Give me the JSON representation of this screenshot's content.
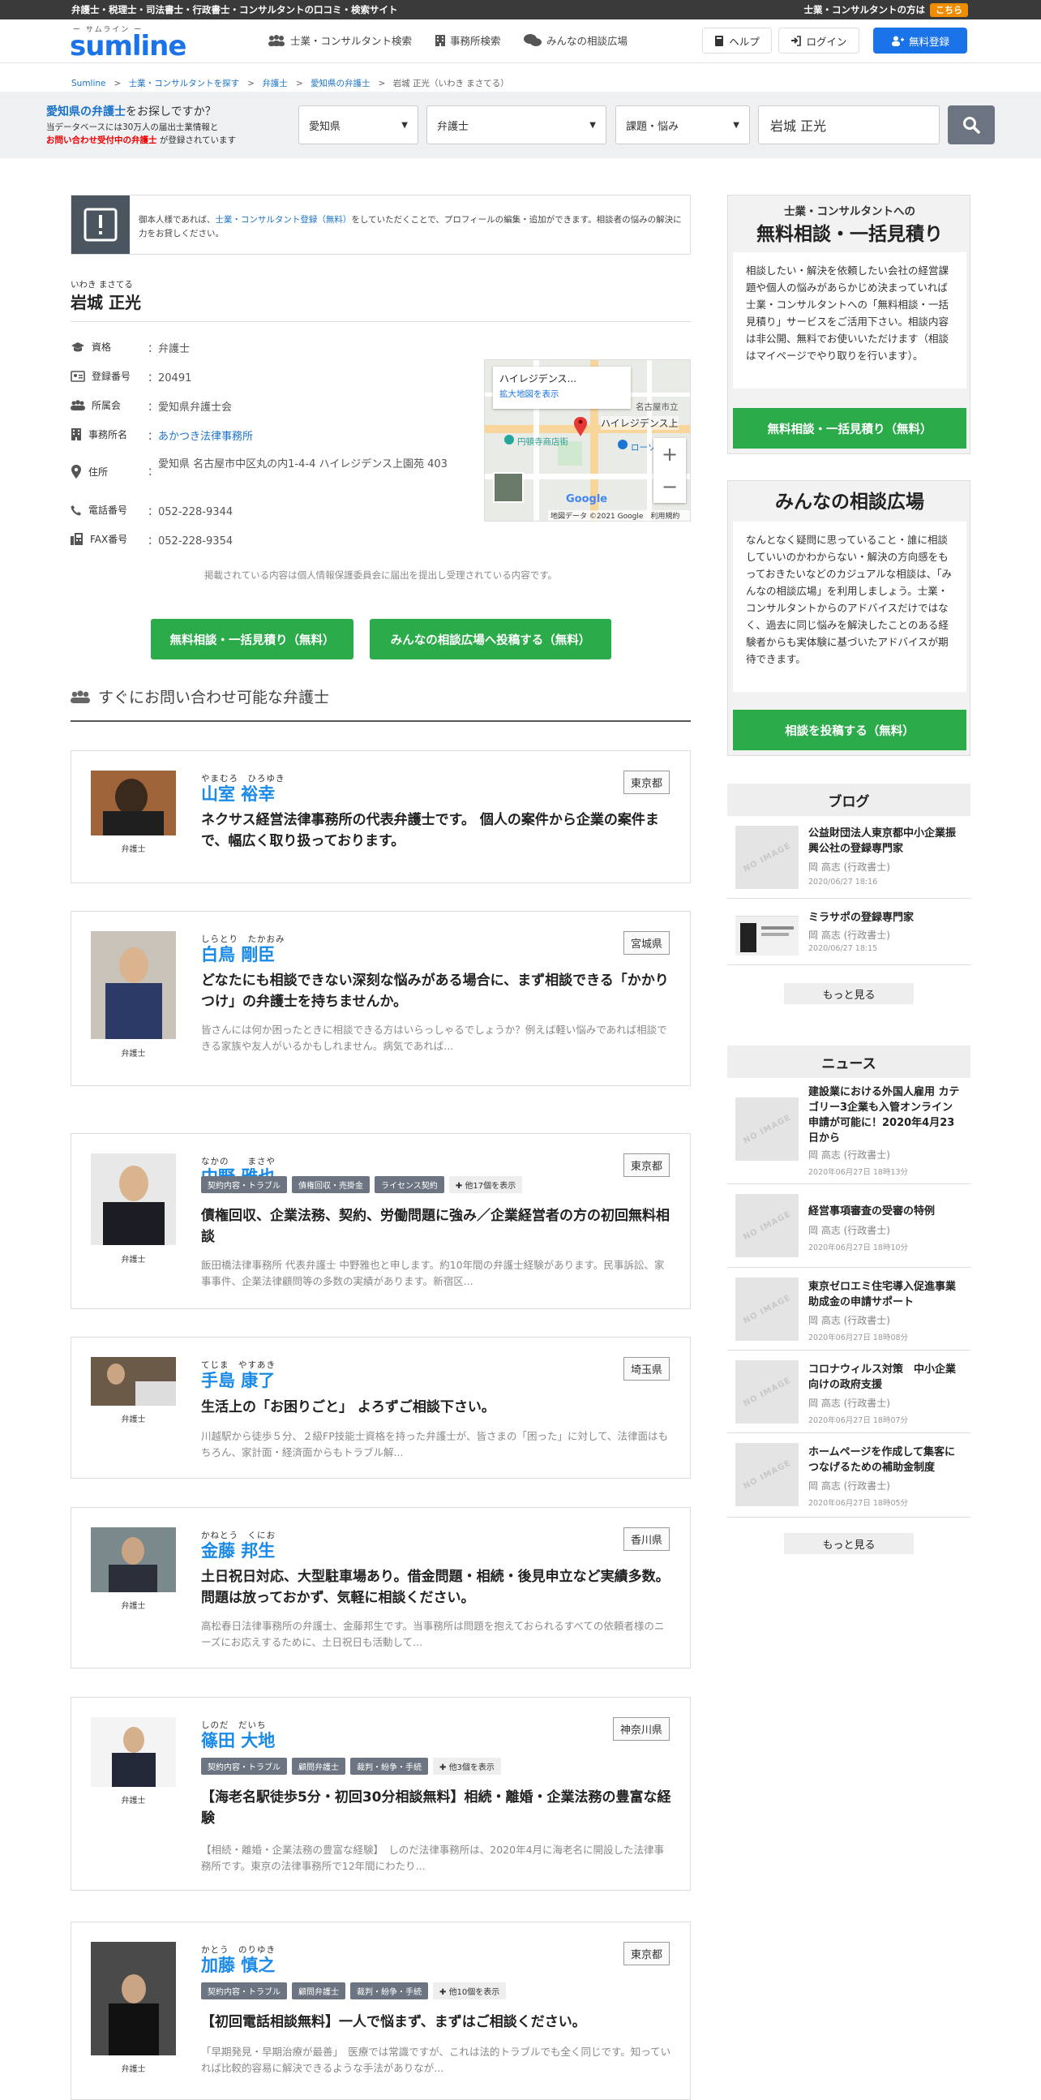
{
  "topbar": {
    "tagline": "弁護士・税理士・司法書士・行政書士・コンサルタントの口コミ・検索サイト",
    "right_text": "士業・コンサルタントの方は",
    "right_link": "こちら"
  },
  "header": {
    "logo_ruby": "ー サムライン ー",
    "logo_text": "sumline",
    "nav": [
      "士業・コンサルタント検索",
      "事務所検索",
      "みんなの相談広場"
    ],
    "help": "ヘルプ",
    "login": "ログイン",
    "register": "無料登録"
  },
  "breadcrumb": [
    "Sumline",
    "士業・コンサルタントを探す",
    "弁護士",
    "愛知県の弁護士",
    "岩城 正光（いわき まさてる）"
  ],
  "search": {
    "q_link": "愛知県の弁護士",
    "q_rest": "をお探しですか？",
    "info1": "当データベースには30万人の届出士業情報と",
    "info2_red": "お問い合わせ受付中の弁護士",
    "info2_rest": "が登録されています",
    "pref": "愛知県",
    "category": "弁護士",
    "issue": "課題・悩み",
    "keyword": "岩城 正光"
  },
  "notice": {
    "pre": "御本人様であれば、",
    "link": "士業・コンサルタント登録（無料）",
    "post": "をしていただくことで、プロフィールの編集・追加ができます。相談者の悩みの解決に力をお貸しください。"
  },
  "profile": {
    "ruby": "いわき まさてる",
    "name": "岩城 正光",
    "rows": [
      {
        "label": "資格",
        "value": "弁護士"
      },
      {
        "label": "登録番号",
        "value": "20491"
      },
      {
        "label": "所属会",
        "value": "愛知県弁護士会"
      },
      {
        "label": "事務所名",
        "value": "あかつき法律事務所"
      },
      {
        "label": "住所",
        "value": "愛知県 名古屋市中区丸の内1-4-4 ハイレジデンス上園苑 403"
      },
      {
        "label": "電話番号",
        "value": "052-228-9344"
      },
      {
        "label": "FAX番号",
        "value": "052-228-9354"
      }
    ],
    "map": {
      "place": "ハイレジデンス...",
      "enlarge": "拡大地図を表示",
      "label1": "ハイレジデンス上",
      "label2": "名古屋市立",
      "label3": "円頓寺商店街",
      "label4": "ローソン",
      "credit": "地図データ ©2021 Google　利用規約",
      "google": "Google"
    },
    "disclaimer": "掲載されている内容は個人情報保護委員会に届出を提出し受理されている内容です。",
    "btn1": "無料相談・一括見積り（無料）",
    "btn2": "みんなの相談広場へ投稿する（無料）"
  },
  "section_title": "すぐにお問い合わせ可能な弁護士",
  "lawyers": [
    {
      "kana": "やまむろ　ひろゆき",
      "name": "山室 裕幸",
      "pref": "東京都",
      "role": "弁護士",
      "tags": [],
      "headline": "ネクサス経営法律事務所の代表弁護士です。 個人の案件から企業の案件まで、幅広く取り扱っております。",
      "desc": ""
    },
    {
      "kana": "しらとり　たかおみ",
      "name": "白鳥 剛臣",
      "pref": "宮城県",
      "role": "弁護士",
      "tags": [],
      "headline": "どなたにも相談できない深刻な悩みがある場合に、まず相談できる「かかりつけ」の弁護士を持ちませんか。",
      "desc": "皆さんには何か困ったときに相談できる方はいらっしゃるでしょうか？例えば軽い悩みであれば相談できる家族や友人がいるかもしれません。病気であれば..."
    },
    {
      "kana": "なかの　　まさや",
      "name": "中野 雅也",
      "pref": "東京都",
      "role": "弁護士",
      "tags": [
        "契約内容・トラブル",
        "債権回収・売掛金",
        "ライセンス契約"
      ],
      "more": "他17個を表示",
      "headline": "債権回収、企業法務、契約、労働問題に強み／企業経営者の方の初回無料相談",
      "desc": "飯田橋法律事務所 代表弁護士 中野雅也と申します。約10年間の弁護士経験があります。民事訴訟、家事事件、企業法律顧問等の多数の実績があります。新宿区..."
    },
    {
      "kana": "てじま　やすあき",
      "name": "手島 康了",
      "pref": "埼玉県",
      "role": "弁護士",
      "tags": [],
      "headline": "生活上の「お困りごと」 よろずご相談下さい。",
      "desc": "川越駅から徒歩５分、２級FP技能士資格を持った弁護士が、皆さまの「困った」に対して、法律面はもちろん、家計面・経済面からもトラブル解..."
    },
    {
      "kana": "かねとう　くにお",
      "name": "金藤 邦生",
      "pref": "香川県",
      "role": "弁護士",
      "tags": [],
      "headline": "土日祝日対応、大型駐車場あり。借金問題・相続・後見申立など実績多数。 問題は放っておかず、気軽に相談ください。",
      "desc": "高松春日法律事務所の弁護士、金藤邦生です。当事務所は問題を抱えておられるすべての依頼者様のニーズにお応えするために、土日祝日も活動して..."
    },
    {
      "kana": "しのだ　だいち",
      "name": "篠田 大地",
      "pref": "神奈川県",
      "role": "弁護士",
      "tags": [
        "契約内容・トラブル",
        "顧問弁護士",
        "裁判・紛争・手続"
      ],
      "more": "他3個を表示",
      "headline": "【海老名駅徒歩5分・初回30分相談無料】相続・離婚・企業法務の豊富な経験",
      "desc": "【相続・離婚・企業法務の豊富な経験】　しのだ法律事務所は、2020年4月に海老名に開設した法律事務所です。東京の法律事務所で12年間にわたり..."
    },
    {
      "kana": "かとう　のりゆき",
      "name": "加藤 慎之",
      "pref": "東京都",
      "role": "弁護士",
      "tags": [
        "契約内容・トラブル",
        "顧問弁護士",
        "裁判・紛争・手続"
      ],
      "more": "他10個を表示",
      "headline": "【初回電話相談無料】一人で悩まず、まずはご相談ください。",
      "desc": "「早期発見・早期治療が最善」　医療では常識ですが、これは法的トラブルでも全く同じです。知っていれば比較的容易に解決できるような手法がありなが..."
    }
  ],
  "sidebar": {
    "box1": {
      "top": "士業・コンサルタントへの",
      "title": "無料相談・一括見積り",
      "body": "相談したい・解決を依頼したい会社の経営課題や個人の悩みがあらかじめ決まっていれば士業・コンサルタントへの「無料相談・一括見積り」サービスをご活用下さい。相談内容は非公開、無料でお使いいただけます（相談はマイページでやり取りを行います）。",
      "btn": "無料相談・一括見積り（無料）"
    },
    "box2": {
      "title": "みんなの相談広場",
      "body": "なんとなく疑問に思っていること・誰に相談していいのかわからない・解決の方向感をもっておきたいなどのカジュアルな相談は、「みんなの相談広場」を利用しましょう。士業・コンサルタントからのアドバイスだけではなく、過去に同じ悩みを解決したことのある経験者からも実体験に基づいたアドバイスが期待できます。",
      "btn": "相談を投稿する（無料）"
    },
    "blog_title": "ブログ",
    "blog": [
      {
        "title": "公益財団法人東京都中小企業振興公社の登録専門家",
        "author": "岡 高志 (行政書士)",
        "date": "2020/06/27 18:16",
        "thumb": "NO IMAGE"
      },
      {
        "title": "ミラサポの登録専門家",
        "author": "岡 高志 (行政書士)",
        "date": "2020/06/27 18:15",
        "thumb": ""
      }
    ],
    "more": "もっと見る",
    "news_title": "ニュース",
    "news": [
      {
        "title": "建設業における外国人雇用 カテゴリー3企業も入管オンライン申請が可能に！2020年4月23日から",
        "author": "岡 高志 (行政書士)",
        "date": "2020年06月27日 18時13分"
      },
      {
        "title": "経営事項審査の受審の特例",
        "author": "岡 高志 (行政書士)",
        "date": "2020年06月27日 18時10分"
      },
      {
        "title": "東京ゼロエミ住宅導入促進事業　助成金の申請サポート",
        "author": "岡 高志 (行政書士)",
        "date": "2020年06月27日 18時08分"
      },
      {
        "title": "コロナウィルス対策　中小企業向けの政府支援",
        "author": "岡 高志 (行政書士)",
        "date": "2020年06月27日 18時07分"
      },
      {
        "title": "ホームページを作成して集客につなげるための補助金制度",
        "author": "岡 高志 (行政書士)",
        "date": "2020年06月27日 18時05分"
      }
    ],
    "no_image": "NO IMAGE"
  },
  "colors": {
    "accent": "#1a73e8",
    "green": "#2bab4a",
    "topbar": "#3a3a3a",
    "orange": "#f08c00"
  }
}
